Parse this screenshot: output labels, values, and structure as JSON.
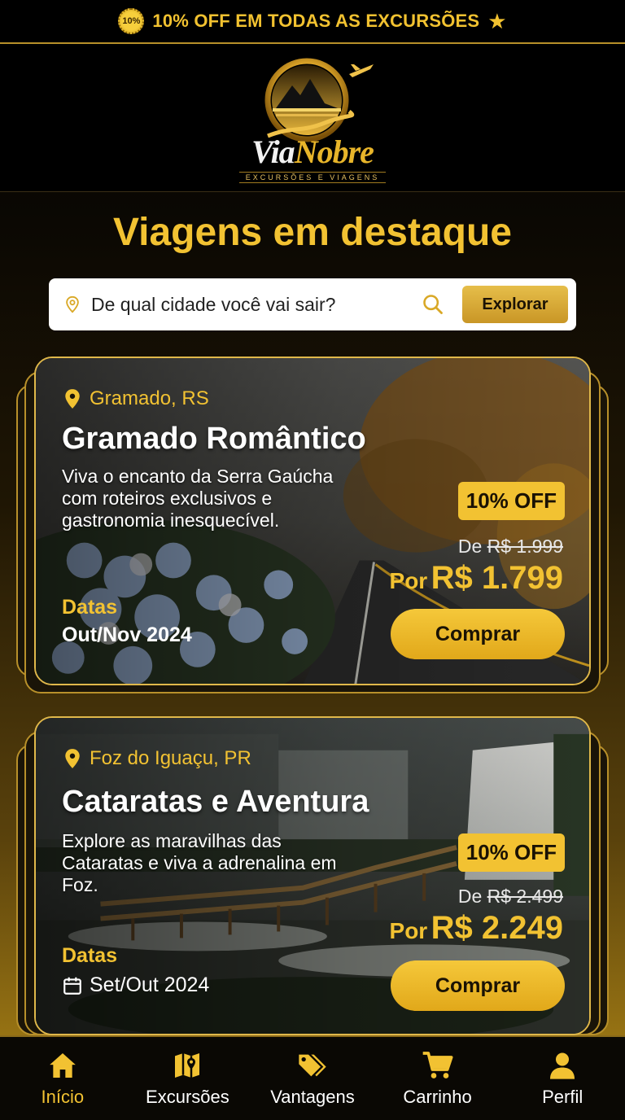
{
  "promo": {
    "badge": "10%",
    "text": "10% OFF EM TODAS AS EXCURSÕES",
    "icon": "star-icon"
  },
  "brand": {
    "logo_via": "Via",
    "logo_nobre": "Nobre",
    "tagline": "EXCURSÕES E VIAGENS",
    "accent": "#f2c232"
  },
  "section_title": "Viagens em destaque",
  "search": {
    "placeholder": "De qual cidade você vai sair?",
    "button_label": "Explorar"
  },
  "trips": [
    {
      "location": "Gramado, RS",
      "title": "Gramado Romântico",
      "description": "Viva o encanto da Serra Gaúcha com roteiros exclusivos e gastronomia inesquecível.",
      "discount": "10% OFF",
      "old_price_prefix": "De",
      "old_price": "R$ 1.999",
      "new_price_prefix": "Por",
      "new_price": "R$ 1.799",
      "dates_label": "Datas",
      "dates": "Out/Nov 2024",
      "buy_label": "Comprar"
    },
    {
      "location": "Foz do Iguaçu, PR",
      "title": "Cataratas e Aventura",
      "description": "Explore as maravilhas das Cataratas e viva a adrenalina em Foz.",
      "discount": "10% OFF",
      "old_price_prefix": "De",
      "old_price": "R$ 2.499",
      "new_price_prefix": "Por",
      "new_price": "R$ 2.249",
      "dates_label": "Datas",
      "dates": "Set/Out 2024",
      "buy_label": "Comprar"
    }
  ],
  "nav": [
    {
      "label": "Início",
      "icon": "home-icon",
      "active": true
    },
    {
      "label": "Excursões",
      "icon": "map-icon",
      "active": false
    },
    {
      "label": "Vantagens",
      "icon": "tags-icon",
      "active": false
    },
    {
      "label": "Carrinho",
      "icon": "cart-icon",
      "active": false
    },
    {
      "label": "Perfil",
      "icon": "user-icon",
      "active": false
    }
  ]
}
